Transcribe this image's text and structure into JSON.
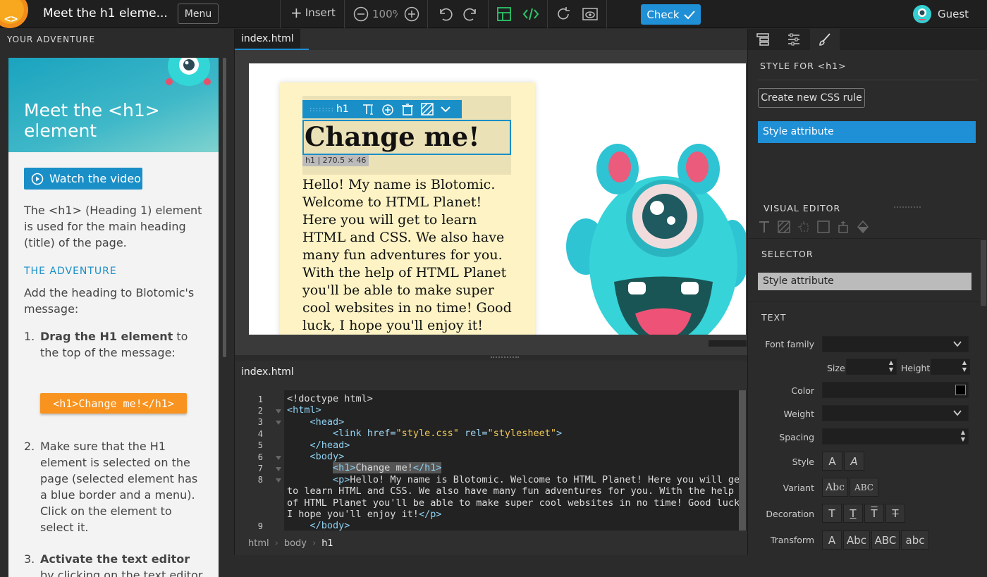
{
  "app": {
    "title": "Meet the h1 eleme...",
    "menu_label": "Menu",
    "insert_label": "Insert",
    "zoom": "100%",
    "check_label": "Check",
    "user_name": "Guest"
  },
  "left": {
    "header": "YOUR ADVENTURE",
    "title": "Meet the <h1> element",
    "watch_label": "Watch the video",
    "intro": "The <h1> (Heading 1) element is used for the main heading (title) of the page.",
    "adventure_heading": "THE ADVENTURE",
    "adventure_text": "Add the heading to Blotomic's message:",
    "steps": [
      {
        "num": "1.",
        "bold": "Drag the H1 element",
        "rest": " to the top of the message:"
      },
      {
        "num": "2.",
        "text": "Make sure that the H1 element is selected on the page (selected element has a blue border and a menu). Click on the element to select it."
      },
      {
        "num": "3.",
        "bold": "Activate the text editor",
        "rest": " by clicking on the text editor "
      }
    ],
    "code_chip": "<h1>Change me!</h1>"
  },
  "preview": {
    "tab": "index.html",
    "sel_tag": "h1",
    "heading": "Change me!",
    "dims": "h1 | 270.5 × 46",
    "paragraph": "Hello! My name is Blotomic. Welcome to HTML Planet! Here you will get to learn HTML and CSS. We also have many fun adventures for you. With the help of HTML Planet you'll be able to make super cool websites in no time! Good luck, I hope you'll enjoy it!"
  },
  "editor": {
    "tab": "index.html",
    "line_numbers": [
      "1",
      "2",
      "3",
      "4",
      "5",
      "6",
      "7",
      "8",
      "9"
    ],
    "breadcrumb": [
      "html",
      "body",
      "h1"
    ]
  },
  "right": {
    "style_for": "STYLE FOR  <h1>",
    "create_rule": "Create new CSS rule",
    "style_attribute": "Style attribute",
    "visual_editor": "VISUAL EDITOR",
    "selector_heading": "SELECTOR",
    "selector_value": "Style attribute",
    "text_heading": "TEXT",
    "labels": {
      "font_family": "Font family",
      "size": "Size",
      "height": "Height",
      "color": "Color",
      "weight": "Weight",
      "spacing": "Spacing",
      "style": "Style",
      "variant": "Variant",
      "decoration": "Decoration",
      "transform": "Transform"
    },
    "style_opts": [
      "A",
      "A"
    ],
    "variant_opts": [
      "Abc",
      "ABC"
    ],
    "decoration_opts": [
      "T",
      "T",
      "T",
      "T"
    ],
    "transform_opts": [
      "A",
      "Abc",
      "ABC",
      "abc"
    ],
    "color_swatch": "#000000"
  },
  "colors": {
    "accent": "#1f8fd6",
    "chip": "#f7931e",
    "monster": "#33d6d6"
  }
}
